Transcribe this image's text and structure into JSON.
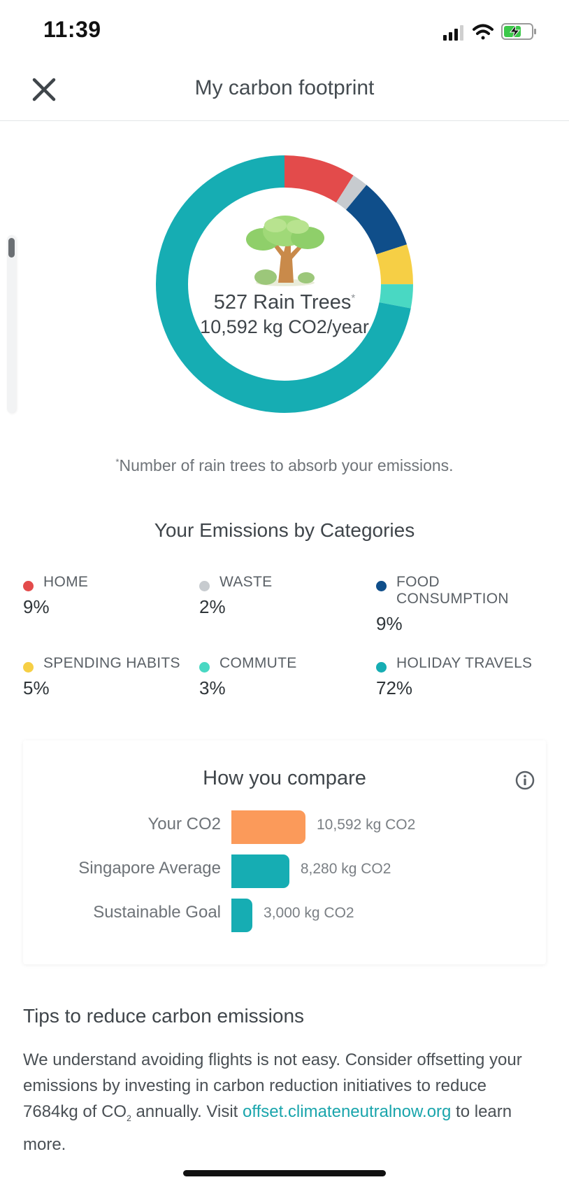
{
  "status_bar": {
    "time": "11:39"
  },
  "header": {
    "title": "My carbon footprint"
  },
  "summary": {
    "trees": "527 Rain Trees",
    "trees_mark": "*",
    "kg_per_year": "10,592 kg CO2/year",
    "footnote_mark": "*",
    "footnote": "Number of rain trees to absorb your emissions."
  },
  "categories": {
    "title": "Your Emissions by Categories",
    "items": [
      {
        "name": "HOME",
        "percent": "9%",
        "color": "#e34b4b",
        "share": 9
      },
      {
        "name": "WASTE",
        "percent": "2%",
        "color": "#c7cbcf",
        "share": 2
      },
      {
        "name": "FOOD CONSUMPTION",
        "percent": "9%",
        "color": "#0f4e8a",
        "share": 9
      },
      {
        "name": "SPENDING HABITS",
        "percent": "5%",
        "color": "#f6cf45",
        "share": 5
      },
      {
        "name": "COMMUTE",
        "percent": "3%",
        "color": "#49d8c3",
        "share": 3
      },
      {
        "name": "HOLIDAY TRAVELS",
        "percent": "72%",
        "color": "#16adb3",
        "share": 72
      }
    ]
  },
  "compare": {
    "title": "How you compare",
    "rows": [
      {
        "label": "Your CO2",
        "value_text": "10,592 kg CO2",
        "value": 10592,
        "color": "#fb9a5a"
      },
      {
        "label": "Singapore Average",
        "value_text": "8,280 kg CO2",
        "value": 8280,
        "color": "#16adb3"
      },
      {
        "label": "Sustainable Goal",
        "value_text": "3,000 kg CO2",
        "value": 3000,
        "color": "#16adb3"
      }
    ]
  },
  "tips": {
    "title": "Tips to reduce carbon emissions",
    "text_1": "We understand avoiding flights is not easy. Consider offsetting your emissions by investing in carbon reduction initiatives to reduce 7684kg of CO",
    "subscript": "2",
    "text_2": " annually. Visit ",
    "link": "offset.climateneutralnow.org",
    "text_3": " to learn more."
  }
}
